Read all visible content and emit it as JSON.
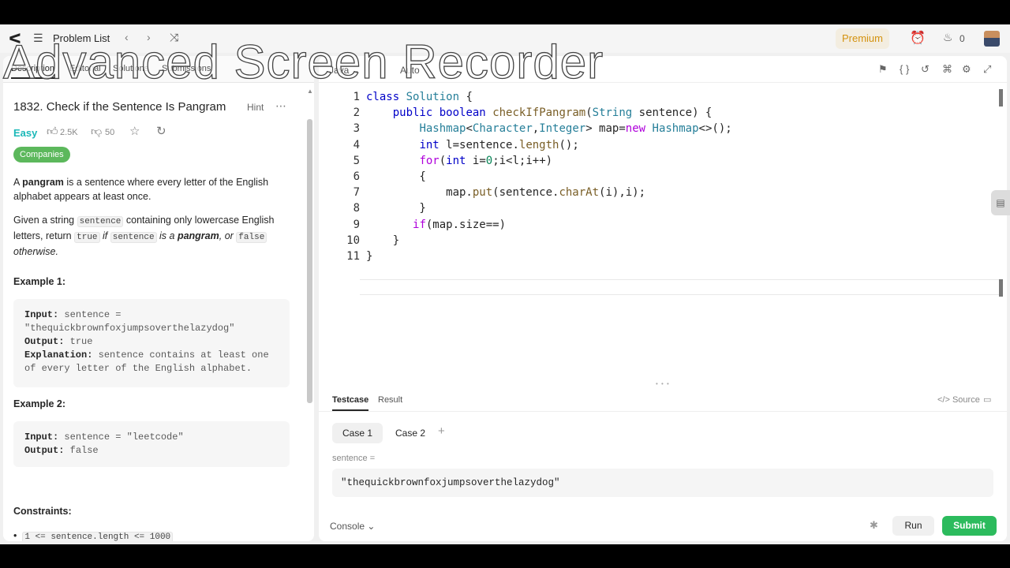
{
  "watermark": "Advanced Screen Recorder",
  "topnav": {
    "problem_list": "Problem List",
    "prev": "‹",
    "next": "›",
    "premium": "Premium",
    "streak": "0"
  },
  "left_tabs": [
    "Description",
    "Editorial",
    "Solutions",
    "Submissions"
  ],
  "problem": {
    "title": "1832. Check if the Sentence Is Pangram",
    "hint": "Hint",
    "difficulty": "Easy",
    "likes": "2.5K",
    "dislikes": "50",
    "companies": "Companies",
    "p1_a": "A ",
    "p1_b": "pangram",
    "p1_c": " is a sentence where every letter of the English alphabet appears at least once.",
    "p2_a": "Given a string ",
    "p2_code1": "sentence",
    "p2_b": " containing only lowercase English letters, return ",
    "p2_code2": "true",
    "p2_c": " if ",
    "p2_code3": "sentence",
    "p2_d": " is a ",
    "p2_e": "pangram",
    "p2_f": ", or ",
    "p2_code4": "false",
    "p2_g": " otherwise.",
    "example1_title": "Example 1:",
    "example1": {
      "input_label": "Input:",
      "input_value": " sentence = \"thequickbrownfoxjumpsoverthelazydog\"",
      "output_label": "Output:",
      "output_value": " true",
      "explanation_label": "Explanation:",
      "explanation_value": " sentence contains at least one of every letter of the English alphabet."
    },
    "example2_title": "Example 2:",
    "example2": {
      "input_label": "Input:",
      "input_value": " sentence = \"leetcode\"",
      "output_label": "Output:",
      "output_value": " false"
    },
    "constraints_title": "Constraints:",
    "constraint1": "1 <= sentence.length <= 1000"
  },
  "editor": {
    "language": "Java",
    "auto": "Auto",
    "line_numbers": [
      "1",
      "2",
      "3",
      "4",
      "5",
      "6",
      "7",
      "8",
      "9",
      "10",
      "11"
    ]
  },
  "testcase": {
    "tab_testcase": "Testcase",
    "tab_result": "Result",
    "source": "Source",
    "case1": "Case 1",
    "case2": "Case 2",
    "plus": "+",
    "var_label": "sentence =",
    "var_value": "\"thequickbrownfoxjumpsoverthelazydog\"",
    "console": "Console",
    "run": "Run",
    "submit": "Submit"
  },
  "colors": {
    "accent_green": "#2cbb5d",
    "easy": "#1cb8b8",
    "premium": "#d4920f"
  }
}
